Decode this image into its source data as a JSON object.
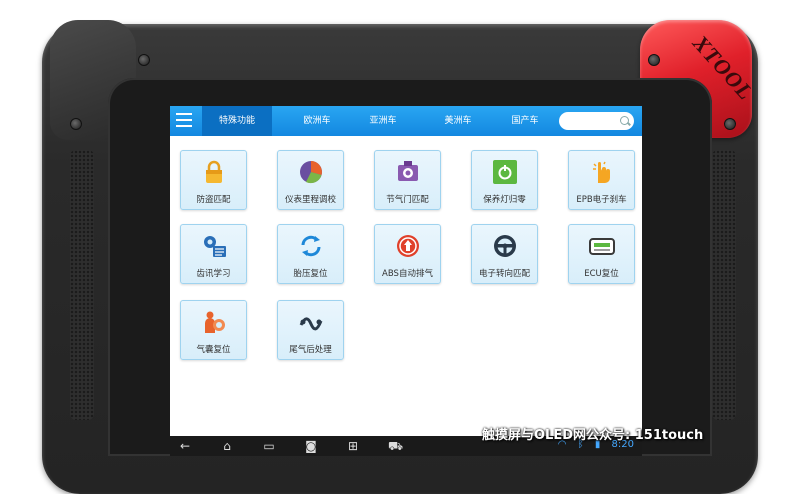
{
  "device": {
    "brand": "XTOOL"
  },
  "topbar": {
    "tabs": [
      {
        "label": "特殊功能",
        "active": true
      },
      {
        "label": "欧洲车"
      },
      {
        "label": "亚洲车"
      },
      {
        "label": "美洲车"
      },
      {
        "label": "国产车"
      }
    ],
    "search": {
      "placeholder": ""
    }
  },
  "tiles": [
    {
      "label": "防盗匹配",
      "icon": "lock-icon"
    },
    {
      "label": "仪表里程调校",
      "icon": "pie-chart-icon"
    },
    {
      "label": "节气门匹配",
      "icon": "throttle-icon"
    },
    {
      "label": "保养灯归零",
      "icon": "service-light-icon"
    },
    {
      "label": "EPB电子刹车",
      "icon": "hand-brake-icon"
    },
    {
      "label": "齿讯学习",
      "icon": "gear-icon"
    },
    {
      "label": "胎压复位",
      "icon": "refresh-icon"
    },
    {
      "label": "ABS自动排气",
      "icon": "abs-icon"
    },
    {
      "label": "电子转向匹配",
      "icon": "steering-wheel-icon"
    },
    {
      "label": "ECU复位",
      "icon": "ecu-icon"
    },
    {
      "label": "气囊复位",
      "icon": "airbag-icon"
    },
    {
      "label": "尾气后处理",
      "icon": "exhaust-icon"
    }
  ],
  "navbar": {
    "time": "8:20"
  },
  "watermark": "触摸屏与OLED网公众号: 151touch",
  "colors": {
    "accent": "#1388e0",
    "bumper": "#e0202a",
    "tile_border": "#9fd3ef"
  }
}
